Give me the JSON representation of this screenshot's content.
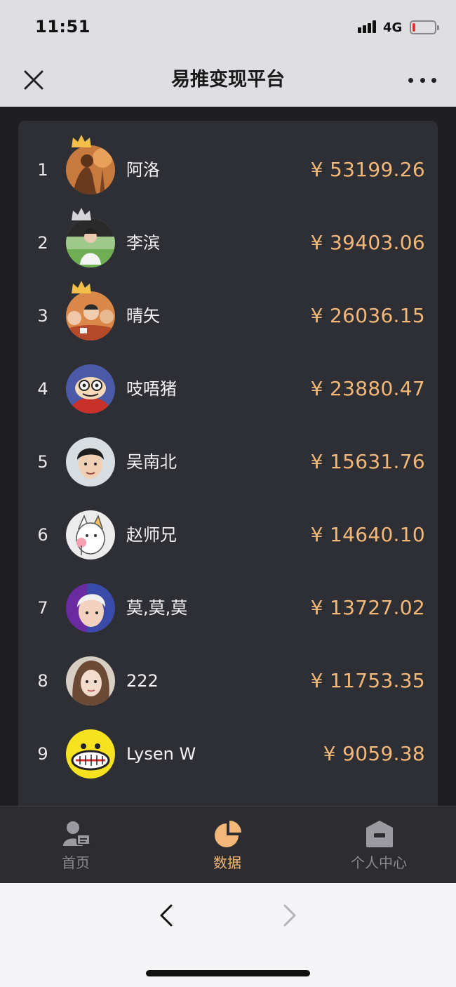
{
  "status_bar": {
    "time": "11:51",
    "network": "4G",
    "battery_color": "#e5322d"
  },
  "nav": {
    "title": "易推变现平台"
  },
  "theme": {
    "accent": "#f3b878",
    "background": "#1f1f23",
    "card": "#2e2e35"
  },
  "leaderboard": [
    {
      "rank": "1",
      "name": "阿洛",
      "amount": "¥ 53199.26",
      "crown": "gold"
    },
    {
      "rank": "2",
      "name": "李滨",
      "amount": "¥ 39403.06",
      "crown": "silver"
    },
    {
      "rank": "3",
      "name": "晴矢",
      "amount": "¥ 26036.15",
      "crown": "bronze"
    },
    {
      "rank": "4",
      "name": "吱唔猪",
      "amount": "¥ 23880.47"
    },
    {
      "rank": "5",
      "name": "吴南北",
      "amount": "¥ 15631.76"
    },
    {
      "rank": "6",
      "name": "赵师兄",
      "amount": "¥ 14640.10"
    },
    {
      "rank": "7",
      "name": "莫,莫,莫",
      "amount": "¥ 13727.02"
    },
    {
      "rank": "8",
      "name": "222",
      "amount": "¥ 11753.35"
    },
    {
      "rank": "9",
      "name": "Lysen W",
      "amount": "¥ 9059.38"
    }
  ],
  "tabs": [
    {
      "label": "首页",
      "icon": "user-card-icon",
      "active": false
    },
    {
      "label": "数据",
      "icon": "pie-chart-icon",
      "active": true
    },
    {
      "label": "个人中心",
      "icon": "home-icon",
      "active": false
    }
  ]
}
